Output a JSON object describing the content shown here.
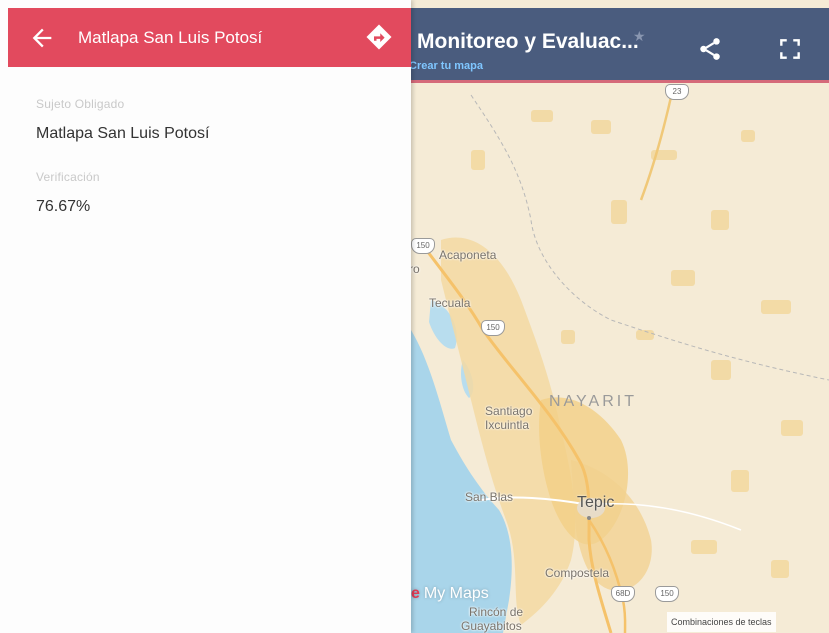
{
  "panel": {
    "title": "Matlapa San Luis Potosí",
    "fields": [
      {
        "label": "Sujeto Obligado",
        "value": "Matlapa San Luis Potosí"
      },
      {
        "label": "Verificación",
        "value": "76.67%"
      }
    ],
    "header_color": "#e24a5e"
  },
  "map_header": {
    "title": "Monitoreo y Evaluac...",
    "link": "Crear tu mapa",
    "color": "#4a5c7e"
  },
  "map": {
    "places": {
      "acaponeta": "Acaponeta",
      "tecuala": "Tecuala",
      "partial": "ro",
      "santiago_1": "Santiago",
      "santiago_2": "Ixcuintla",
      "san_blas": "San Blas",
      "compostela": "Compostela",
      "rincon_1": "Rincón de",
      "rincon_2": "Guayabitos"
    },
    "state_label": "NAYARIT",
    "city_label": "Tepic",
    "highways": [
      "23",
      "150",
      "150",
      "68D",
      "150"
    ],
    "logo": "My Maps",
    "shortcuts": "Combinaciones de teclas"
  },
  "icons": {
    "back": "arrow-left-icon",
    "directions": "directions-icon",
    "star": "star-icon",
    "share": "share-icon",
    "fullscreen": "fullscreen-icon"
  }
}
